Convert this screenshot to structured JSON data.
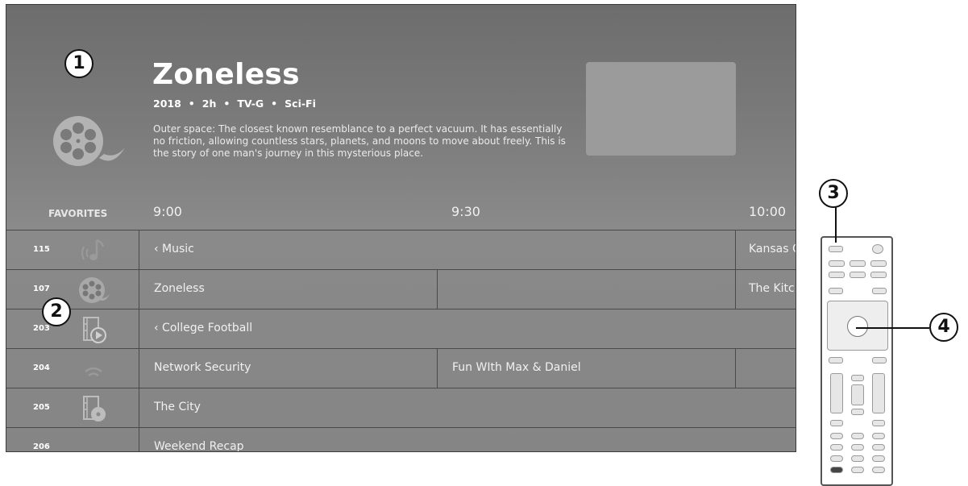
{
  "program": {
    "title": "Zoneless",
    "year": "2018",
    "duration": "2h",
    "rating": "TV-G",
    "genre": "Sci-Fi",
    "separator": "•",
    "description": "Outer space: The closest known resemblance to a perfect vacuum. It has essentially no friction, allowing countless stars, planets, and moons to move about freely. This is the story of one man's journey in this mysterious place."
  },
  "guide": {
    "section_label": "FAVORITES",
    "times": [
      "9:00",
      "9:30",
      "10:00"
    ],
    "rows": [
      {
        "channel": "115",
        "icon": "music-icon",
        "programs": [
          "‹ Music",
          "Kansas City"
        ]
      },
      {
        "channel": "107",
        "icon": "film-reel-icon",
        "programs": [
          "Zoneless",
          "",
          "The Kitchen"
        ]
      },
      {
        "channel": "203",
        "icon": "film-play-icon",
        "programs": [
          "‹ College Football"
        ]
      },
      {
        "channel": "204",
        "icon": "wifi-icon",
        "programs": [
          "Network Security",
          "Fun WIth Max & Daniel",
          ""
        ]
      },
      {
        "channel": "205",
        "icon": "film-disc-icon",
        "programs": [
          "The City"
        ]
      },
      {
        "channel": "206",
        "icon": "",
        "programs": [
          "Weekend Recap"
        ]
      }
    ]
  },
  "callouts": {
    "c1": "1",
    "c2": "2",
    "c3": "3",
    "c4": "4"
  },
  "colors": {
    "background": "#858585",
    "text": "#ffffff",
    "preview": "#9b9b9b",
    "grid_line": "#4a4a4a"
  }
}
